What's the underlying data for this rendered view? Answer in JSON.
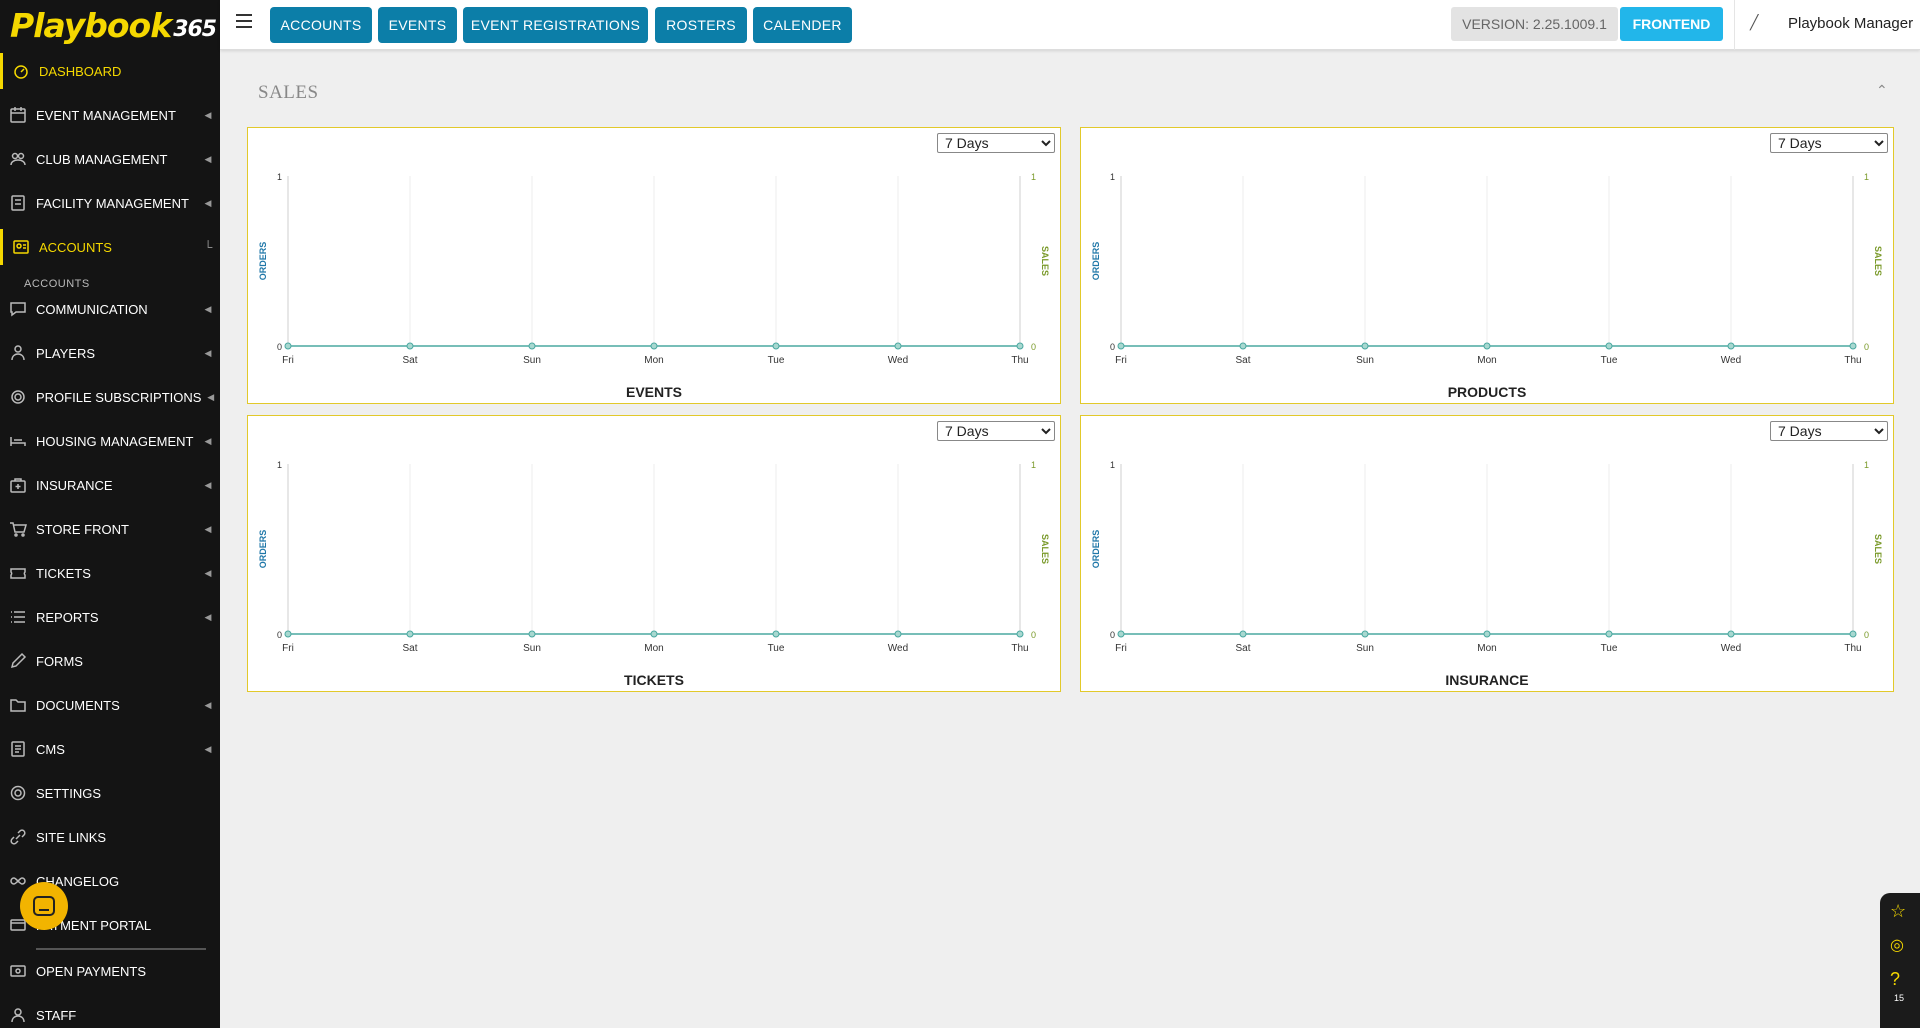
{
  "app": {
    "logo_main": "Playbook",
    "logo_num": "365"
  },
  "sidebar": {
    "items": [
      {
        "label": "DASHBOARD",
        "icon": "dashboard-icon",
        "has_chevron": false,
        "active": true
      },
      {
        "label": "EVENT MANAGEMENT",
        "icon": "calendar-icon",
        "has_chevron": true
      },
      {
        "label": "CLUB MANAGEMENT",
        "icon": "club-icon",
        "has_chevron": true
      },
      {
        "label": "FACILITY MANAGEMENT",
        "icon": "facility-icon",
        "has_chevron": true
      },
      {
        "label": "ACCOUNTS",
        "icon": "accounts-icon",
        "has_chevron": true,
        "active": true,
        "expanded": true
      },
      {
        "label": "COMMUNICATION",
        "icon": "chat-icon",
        "has_chevron": true
      },
      {
        "label": "PLAYERS",
        "icon": "players-icon",
        "has_chevron": true
      },
      {
        "label": "PROFILE SUBSCRIPTIONS",
        "icon": "fingerprint-icon",
        "has_chevron": true
      },
      {
        "label": "HOUSING MANAGEMENT",
        "icon": "bed-icon",
        "has_chevron": true
      },
      {
        "label": "INSURANCE",
        "icon": "medical-bag-icon",
        "has_chevron": true
      },
      {
        "label": "STORE FRONT",
        "icon": "cart-icon",
        "has_chevron": true
      },
      {
        "label": "TICKETS",
        "icon": "ticket-icon",
        "has_chevron": true
      },
      {
        "label": "REPORTS",
        "icon": "list-icon",
        "has_chevron": true
      },
      {
        "label": "FORMS",
        "icon": "pencil-icon",
        "has_chevron": false
      },
      {
        "label": "DOCUMENTS",
        "icon": "folder-icon",
        "has_chevron": true
      },
      {
        "label": "CMS",
        "icon": "cms-icon",
        "has_chevron": true
      },
      {
        "label": "SETTINGS",
        "icon": "gear-icon",
        "has_chevron": false
      },
      {
        "label": "SITE LINKS",
        "icon": "link-icon",
        "has_chevron": false
      },
      {
        "label": "CHANGELOG",
        "icon": "infinity-icon",
        "has_chevron": false
      },
      {
        "label": "PAYMENT PORTAL",
        "icon": "payment-icon",
        "has_chevron": false
      },
      {
        "label": "OPEN PAYMENTS",
        "icon": "money-icon",
        "has_chevron": false
      },
      {
        "label": "STAFF",
        "icon": "staff-icon",
        "has_chevron": false
      }
    ],
    "sub_item": "ACCOUNTS"
  },
  "topbar": {
    "buttons": [
      "ACCOUNTS",
      "EVENTS",
      "EVENT REGISTRATIONS",
      "ROSTERS",
      "CALENDER"
    ],
    "version": "VERSION: 2.25.1009.1",
    "frontend": "FRONTEND",
    "user_name": "Playbook Manager"
  },
  "main": {
    "section_title": "SALES"
  },
  "colors": {
    "accent": "#f5d800",
    "topbar_button": "#0c7ea8",
    "frontend_button": "#22b6ea",
    "orders_axis": "#1f77a8",
    "sales_axis": "#7a9a2a",
    "line": "#4aa8a0"
  },
  "chart_data": [
    {
      "type": "line",
      "title": "EVENTS",
      "categories": [
        "Fri",
        "Sat",
        "Sun",
        "Mon",
        "Tue",
        "Wed",
        "Thu"
      ],
      "y_left_label": "ORDERS",
      "y_right_label": "SALES",
      "ylim": [
        0,
        1
      ],
      "series": [
        {
          "values": [
            0,
            0,
            0,
            0,
            0,
            0,
            0
          ]
        }
      ],
      "range_selector": "7 Days"
    },
    {
      "type": "line",
      "title": "PRODUCTS",
      "categories": [
        "Fri",
        "Sat",
        "Sun",
        "Mon",
        "Tue",
        "Wed",
        "Thu"
      ],
      "y_left_label": "ORDERS",
      "y_right_label": "SALES",
      "ylim": [
        0,
        1
      ],
      "series": [
        {
          "values": [
            0,
            0,
            0,
            0,
            0,
            0,
            0
          ]
        }
      ],
      "range_selector": "7 Days"
    },
    {
      "type": "line",
      "title": "TICKETS",
      "categories": [
        "Fri",
        "Sat",
        "Sun",
        "Mon",
        "Tue",
        "Wed",
        "Thu"
      ],
      "y_left_label": "ORDERS",
      "y_right_label": "SALES",
      "ylim": [
        0,
        1
      ],
      "series": [
        {
          "values": [
            0,
            0,
            0,
            0,
            0,
            0,
            0
          ]
        }
      ],
      "range_selector": "7 Days"
    },
    {
      "type": "line",
      "title": "INSURANCE",
      "categories": [
        "Fri",
        "Sat",
        "Sun",
        "Mon",
        "Tue",
        "Wed",
        "Thu"
      ],
      "y_left_label": "ORDERS",
      "y_right_label": "SALES",
      "ylim": [
        0,
        1
      ],
      "series": [
        {
          "values": [
            0,
            0,
            0,
            0,
            0,
            0,
            0
          ]
        }
      ],
      "range_selector": "7 Days"
    }
  ],
  "float_panel": {
    "icons": [
      "star-icon",
      "broadcast-icon",
      "help-icon"
    ],
    "badge": "15"
  }
}
